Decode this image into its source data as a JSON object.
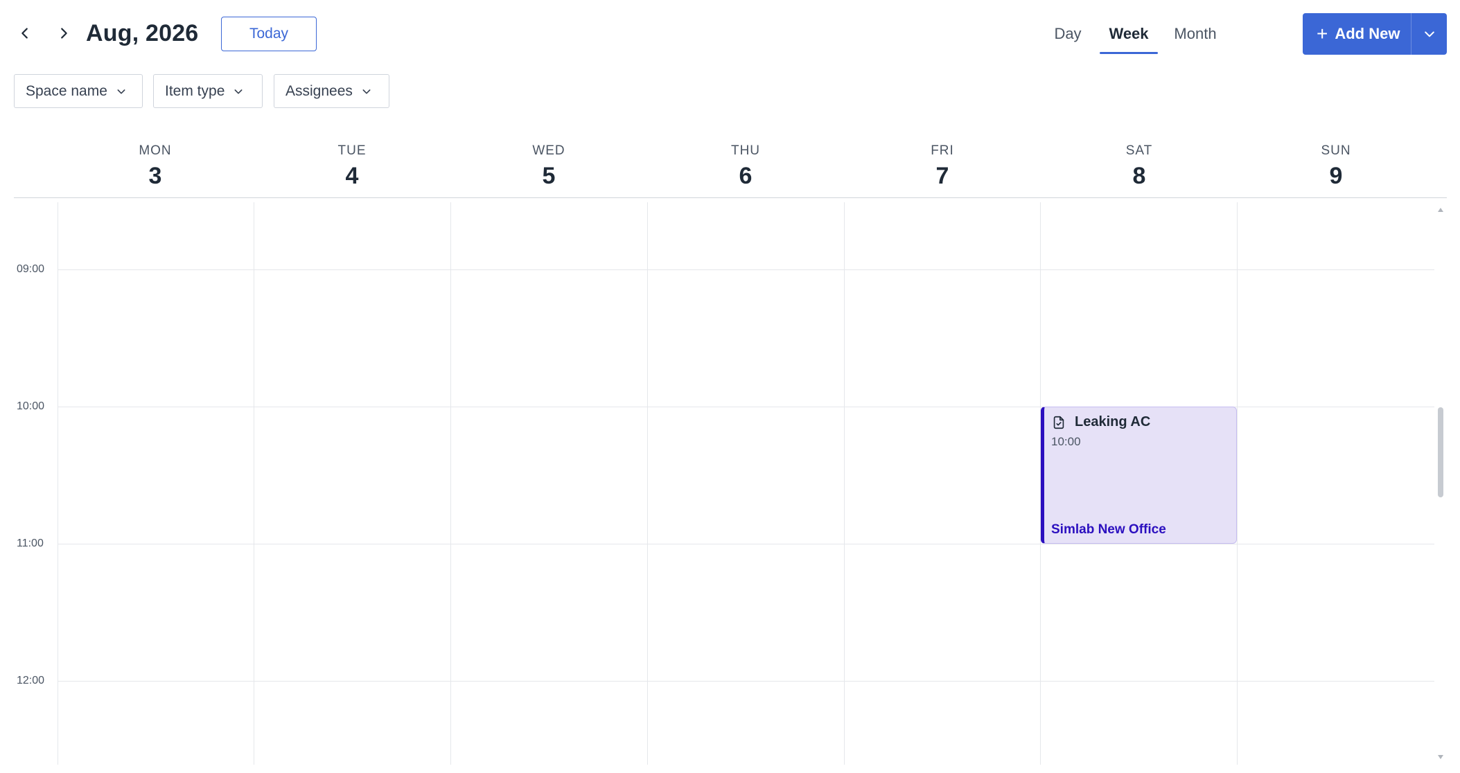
{
  "header": {
    "month_title": "Aug, 2026",
    "today_label": "Today",
    "views": {
      "day": "Day",
      "week": "Week",
      "month": "Month"
    },
    "active_view": "Week",
    "add_new_label": "Add New",
    "accent_color": "#3b67d6"
  },
  "filters": {
    "space": "Space name",
    "type": "Item type",
    "assignees": "Assignees"
  },
  "days": [
    {
      "name": "MON",
      "num": "3"
    },
    {
      "name": "TUE",
      "num": "4"
    },
    {
      "name": "WED",
      "num": "5"
    },
    {
      "name": "THU",
      "num": "6"
    },
    {
      "name": "FRI",
      "num": "7"
    },
    {
      "name": "SAT",
      "num": "8"
    },
    {
      "name": "SUN",
      "num": "9"
    }
  ],
  "times": [
    "09:00",
    "10:00",
    "11:00",
    "12:00"
  ],
  "event": {
    "title": "Leaking AC",
    "time": "10:00",
    "location": "Simlab New Office",
    "icon": "task-document-icon",
    "color": "#2b0fbf",
    "background": "#e6e1f7"
  }
}
